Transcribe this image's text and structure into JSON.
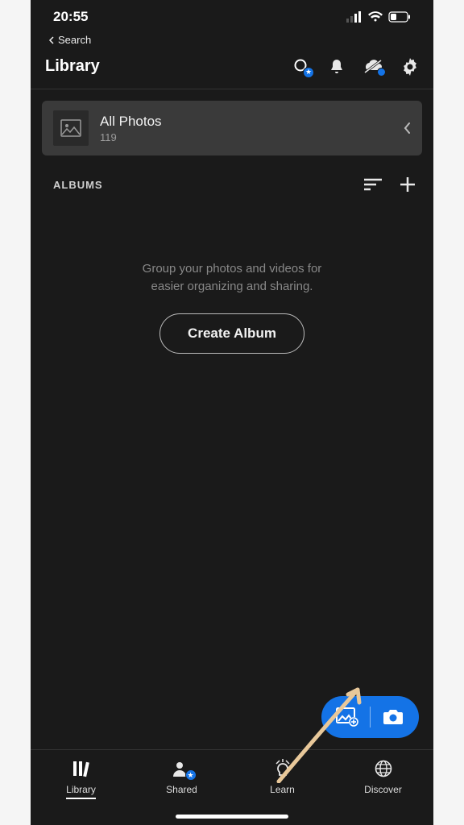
{
  "statusbar": {
    "time": "20:55"
  },
  "back": {
    "label": "Search"
  },
  "header": {
    "title": "Library"
  },
  "allphotos": {
    "title": "All Photos",
    "count": "119"
  },
  "albums": {
    "label": "ALBUMS"
  },
  "empty": {
    "line1": "Group your photos and videos for",
    "line2": "easier organizing and sharing.",
    "button": "Create Album"
  },
  "tabs": {
    "library": "Library",
    "shared": "Shared",
    "learn": "Learn",
    "discover": "Discover"
  },
  "colors": {
    "accent": "#1473e6"
  }
}
